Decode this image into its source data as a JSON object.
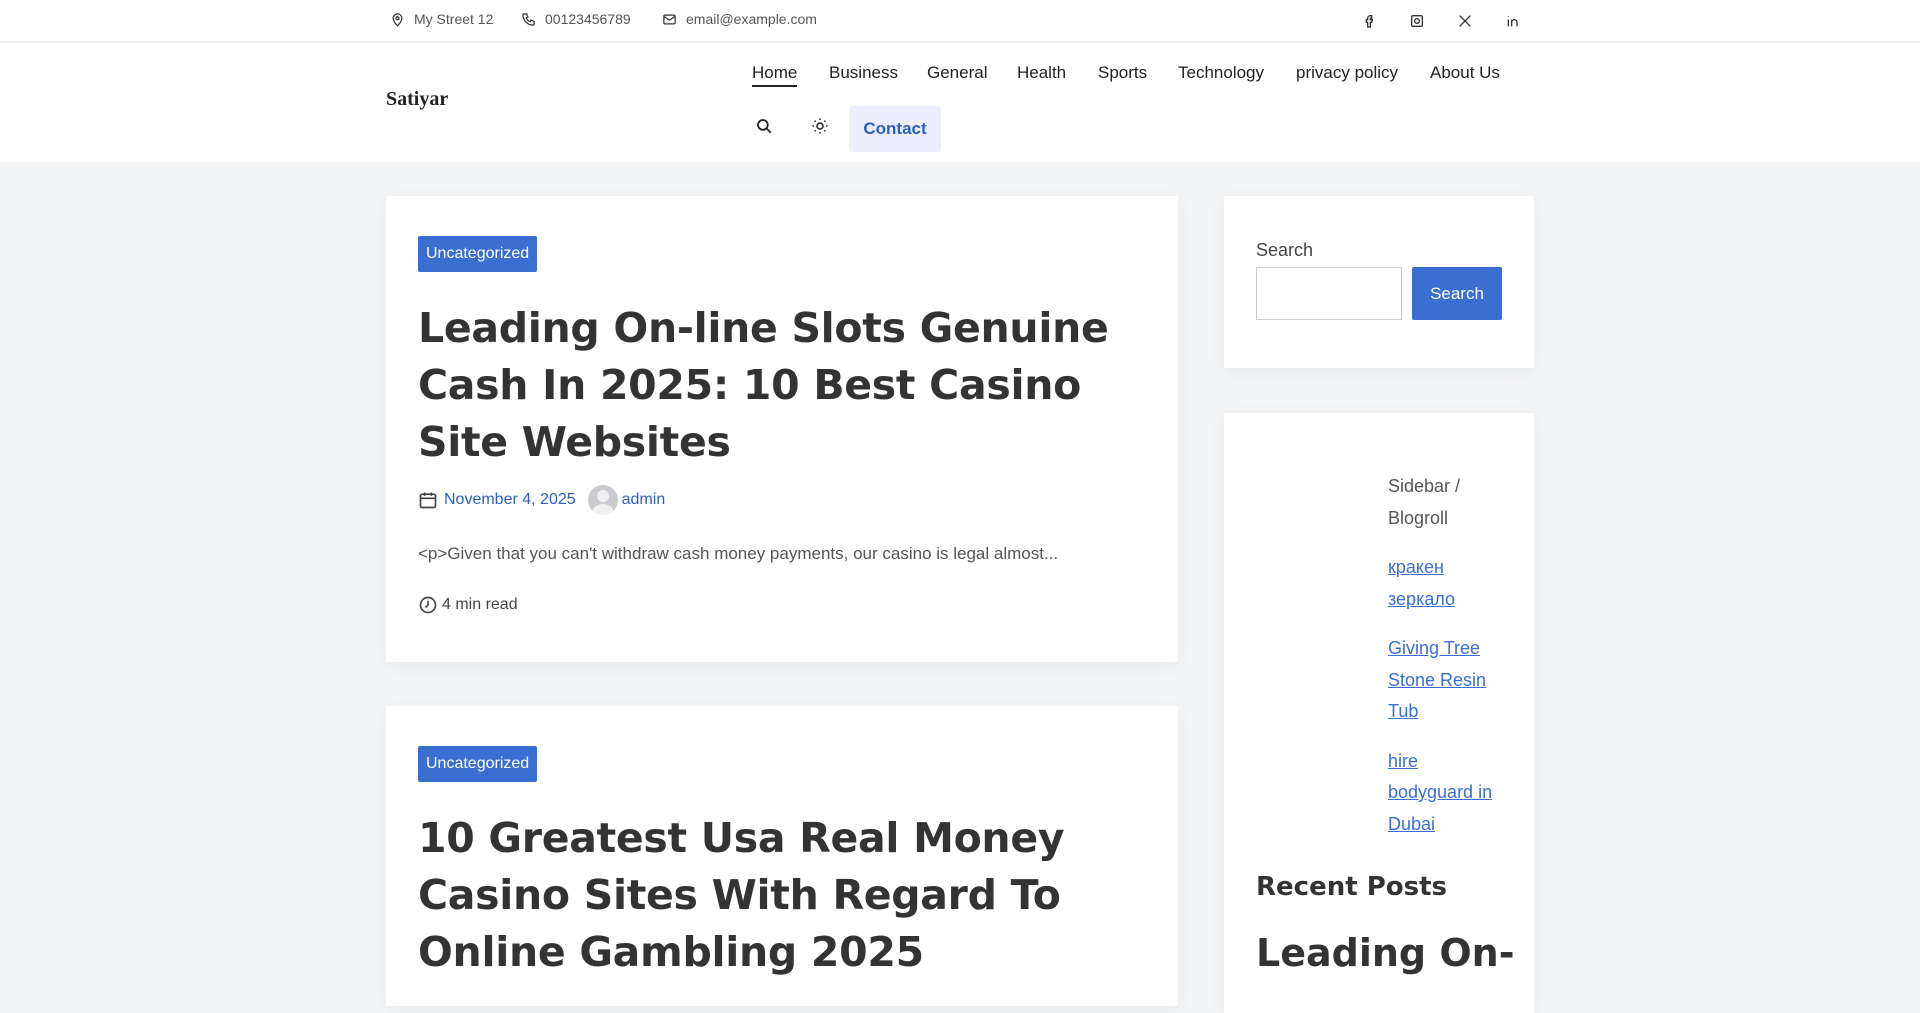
{
  "topbar": {
    "address": "My Street 12",
    "phone": "00123456789",
    "email": "email@example.com",
    "social": [
      "facebook-icon",
      "instagram-icon",
      "x-icon",
      "linkedin-icon"
    ]
  },
  "header": {
    "logo": "Satiyar",
    "nav": [
      "Home",
      "Business",
      "General",
      "Health",
      "Sports",
      "Technology",
      "privacy policy",
      "About Us"
    ],
    "contact_label": "Contact"
  },
  "posts": [
    {
      "category": "Uncategorized",
      "title": "Leading On-line Slots Genuine Cash In 2025: 10 Best Casino Site Websites",
      "date": "November 4, 2025",
      "author": "admin",
      "excerpt": "<p>Given that you can't withdraw cash money payments, our casino is legal almost...",
      "read_time": "4 min read"
    },
    {
      "category": "Uncategorized",
      "title": "10 Greatest Usa Real Money Casino Sites With Regard To Online Gambling 2025"
    }
  ],
  "sidebar": {
    "search_label": "Search",
    "search_button": "Search",
    "blogroll_heading": "Sidebar / Blogroll",
    "blogroll_links": [
      "кракен зеркало",
      "Giving Tree Stone Resin Tub",
      "hire bodyguard in Dubai"
    ],
    "recent_heading": "Recent Posts",
    "recent_first": "Leading On-"
  },
  "colors": {
    "accent": "#3a6fd1",
    "link": "#2c5fc0",
    "contact_bg": "#eceefd",
    "page_bg": "#f3f4f6"
  }
}
